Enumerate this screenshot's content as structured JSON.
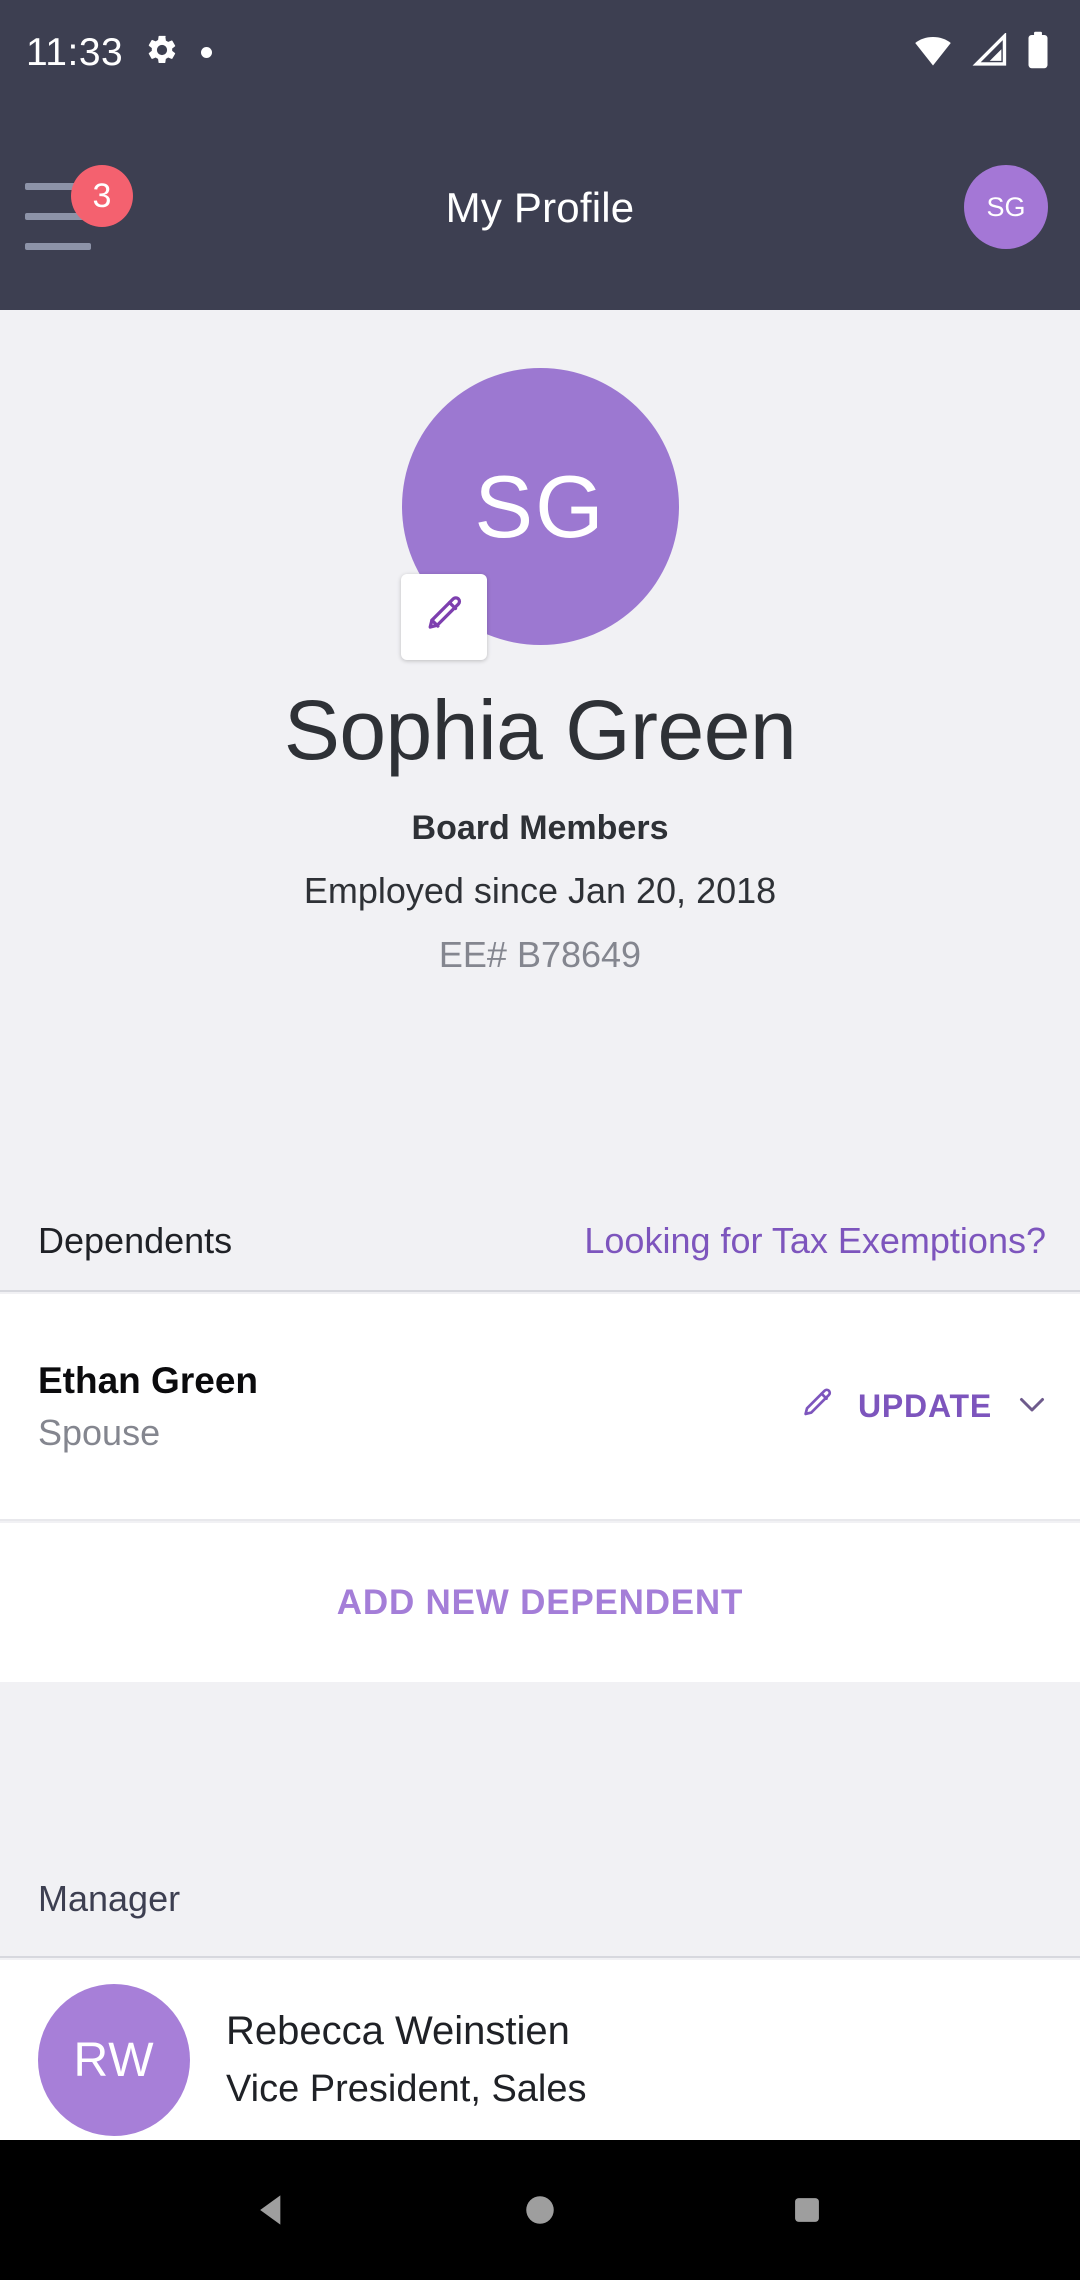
{
  "status_bar": {
    "time": "11:33",
    "icons": [
      "gear-icon",
      "dot-icon",
      "wifi-icon",
      "cellular-signal-icon",
      "battery-icon"
    ],
    "background": "#3D3F51"
  },
  "app_bar": {
    "title": "My Profile",
    "menu_badge_count": "3",
    "badge_color": "#F4616F",
    "avatar_initials": "SG",
    "avatar_color": "#A477D6"
  },
  "hero": {
    "avatar_initials": "SG",
    "avatar_color": "#9C78D1",
    "edit_icon": "pencil-icon",
    "name": "Sophia Green",
    "department": "Board Members",
    "employed_since": "Employed since Jan 20, 2018",
    "employee_number": "EE# B78649"
  },
  "dependents_section": {
    "title": "Dependents",
    "link_label": "Looking for Tax Exemptions?",
    "link_color": "#7D55BD",
    "rows": [
      {
        "name": "Ethan Green",
        "relationship": "Spouse",
        "action_label": "UPDATE",
        "action_icon": "pencil-icon",
        "expand_icon": "chevron-down-icon"
      }
    ],
    "add_label": "ADD NEW DEPENDENT",
    "add_color": "#A47ED8"
  },
  "manager_section": {
    "title": "Manager",
    "person": {
      "initials": "RW",
      "avatar_color": "#A77FD8",
      "name": "Rebecca Weinstien",
      "role": "Vice President, Sales"
    }
  },
  "nav_bar": {
    "back_label": "Back",
    "home_label": "Home",
    "recents_label": "Recents",
    "background": "#000000",
    "icon_color": "#9E9E9E"
  }
}
